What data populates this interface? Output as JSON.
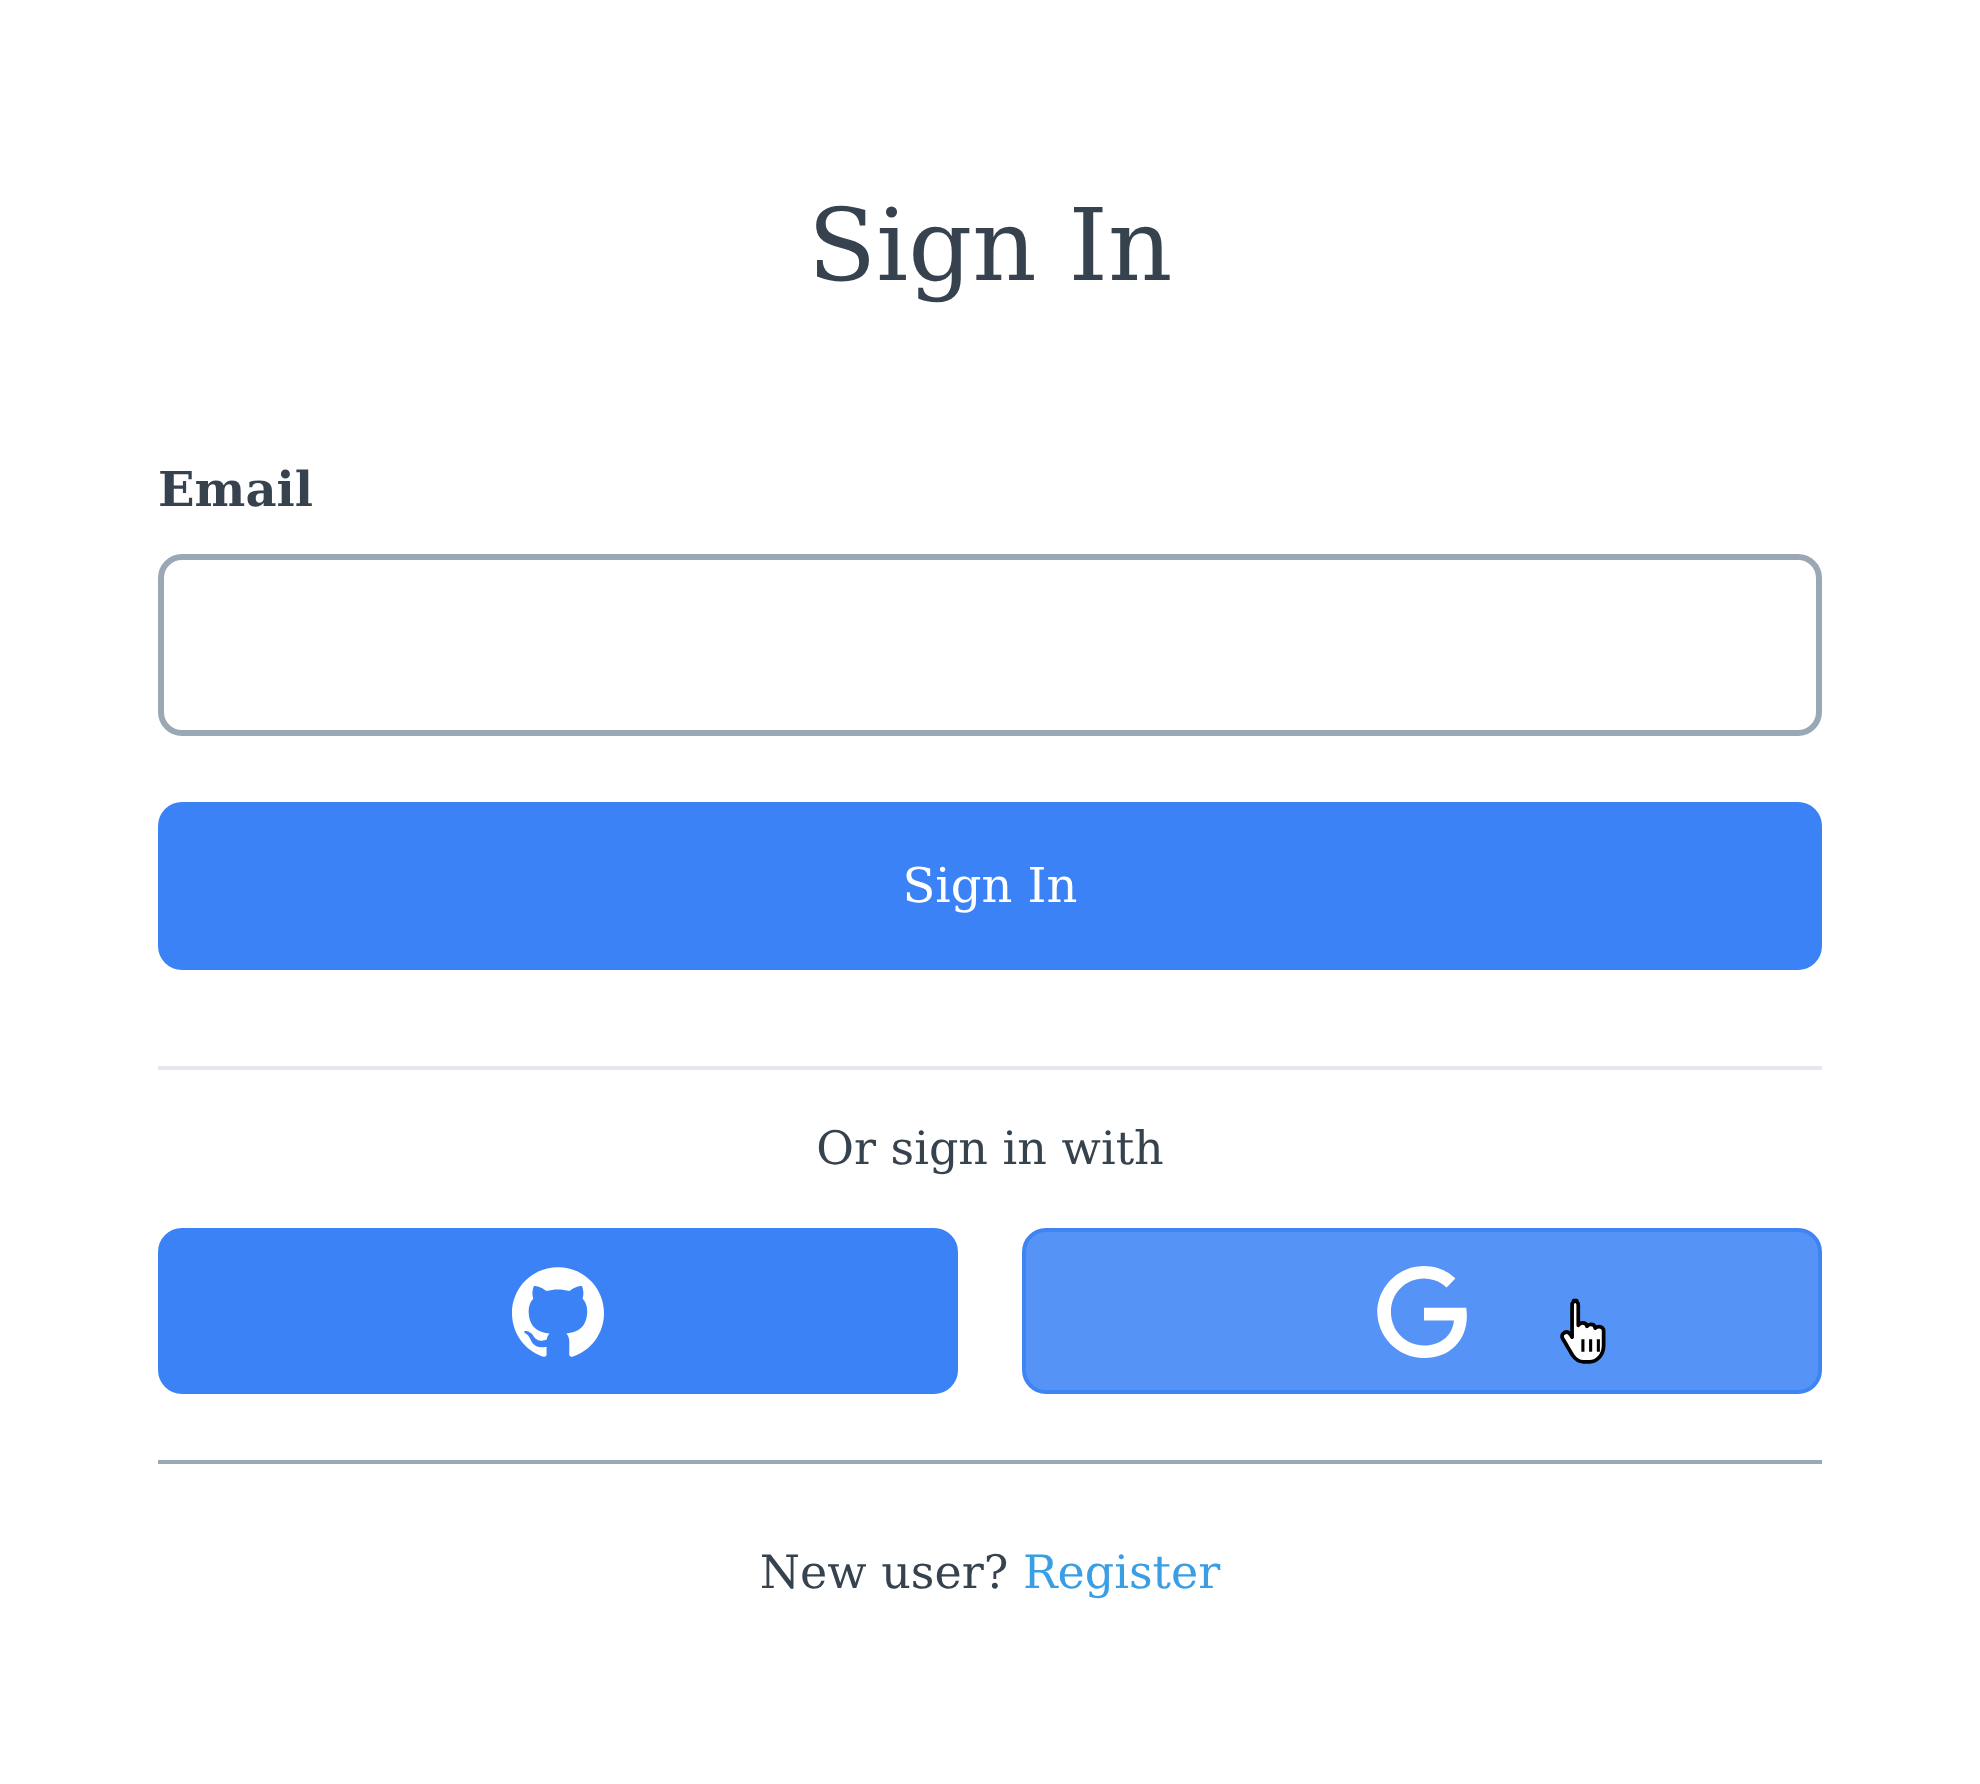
{
  "title": "Sign In",
  "email_field": {
    "label": "Email"
  },
  "submit_button": {
    "label": "Sign In"
  },
  "alternative_text": "Or sign in with",
  "social_buttons": [
    {
      "kind": "github",
      "hovered": false
    },
    {
      "kind": "google",
      "hovered": true
    }
  ],
  "footer": {
    "prompt": "New user?",
    "link": "Register"
  }
}
